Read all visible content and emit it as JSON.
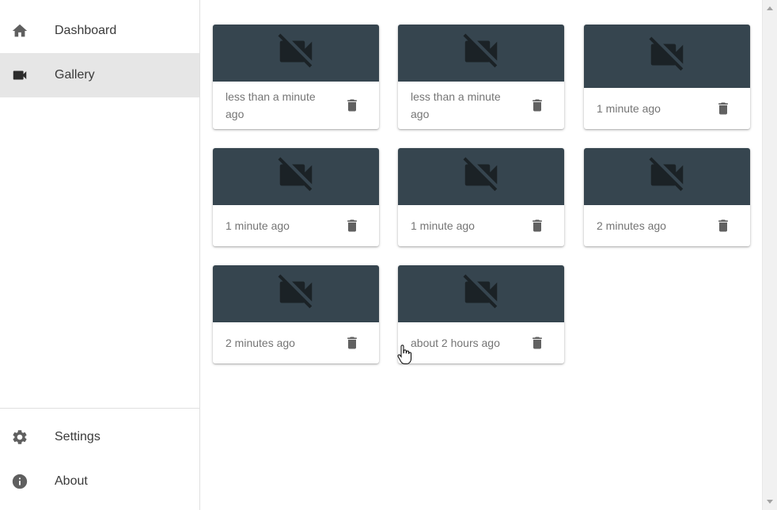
{
  "sidebar": {
    "items": [
      {
        "label": "Dashboard",
        "icon": "home-icon",
        "active": false
      },
      {
        "label": "Gallery",
        "icon": "videocam-icon",
        "active": true
      }
    ],
    "bottom_items": [
      {
        "label": "Settings",
        "icon": "gear-icon"
      },
      {
        "label": "About",
        "icon": "info-icon"
      }
    ]
  },
  "gallery": {
    "cards": [
      {
        "time": "less than a minute ago",
        "thumb_icon": "videocam-off-icon"
      },
      {
        "time": "less than a minute ago",
        "thumb_icon": "videocam-off-icon"
      },
      {
        "time": "1 minute ago",
        "thumb_icon": "videocam-off-icon"
      },
      {
        "time": "1 minute ago",
        "thumb_icon": "videocam-off-icon"
      },
      {
        "time": "1 minute ago",
        "thumb_icon": "videocam-off-icon"
      },
      {
        "time": "2 minutes ago",
        "thumb_icon": "videocam-off-icon"
      },
      {
        "time": "2 minutes ago",
        "thumb_icon": "videocam-off-icon"
      },
      {
        "time": "about 2 hours ago",
        "thumb_icon": "videocam-off-icon"
      }
    ]
  },
  "colors": {
    "thumb_bg": "#36454f",
    "icon_gray": "#5f5f5f",
    "active_bg": "#e6e6e6"
  }
}
